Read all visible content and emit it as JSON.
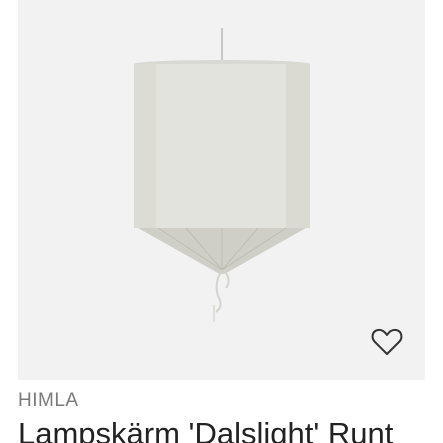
{
  "product": {
    "brand": "HIMLA",
    "title": "Lampskärm 'Dalslight' Runt",
    "image_subject": "lampshade-image",
    "favorite_icon": "heart-outline-icon"
  },
  "colors": {
    "image_background": "#f2f2f2",
    "brand_text": "#7a7a7a",
    "title_text": "#222222",
    "icon_stroke": "#333333",
    "shade_fabric": "#e3e3dd"
  }
}
